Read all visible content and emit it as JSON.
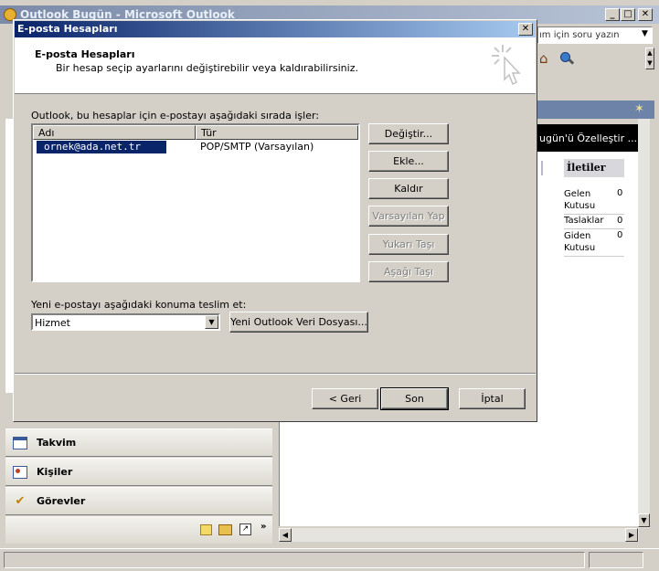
{
  "outlook": {
    "title": "Outlook Bugün - Microsoft Outlook",
    "help_search": "ım için soru yazın",
    "customize_label": "ugün'ü Özelleştir ...",
    "messages_panel": {
      "heading": "İletiler",
      "rows": [
        {
          "label": "Gelen Kutusu",
          "count": "0"
        },
        {
          "label": "Taslaklar",
          "count": "0"
        },
        {
          "label": "Giden Kutusu",
          "count": "0"
        }
      ]
    },
    "nav": {
      "calendar": "Takvim",
      "contacts": "Kişiler",
      "tasks": "Görevler"
    }
  },
  "dialog": {
    "title": "E-posta Hesapları",
    "header_title": "E-posta Hesapları",
    "header_subtitle": "Bir hesap seçip ayarlarını değiştirebilir veya kaldırabilirsiniz.",
    "order_text": "Outlook, bu hesaplar için e-postayı aşağıdaki sırada işler:",
    "columns": {
      "name": "Adı",
      "type": "Tür"
    },
    "accounts": [
      {
        "name": "ornek@ada.net.tr",
        "type": "POP/SMTP (Varsayılan)"
      }
    ],
    "side_buttons": {
      "change": "Değiştir...",
      "add": "Ekle...",
      "remove": "Kaldır",
      "set_default": "Varsayılan Yap",
      "move_up": "Yukarı Taşı",
      "move_down": "Aşağı Taşı"
    },
    "deliver_label": "Yeni e-postayı aşağıdaki konuma teslim et:",
    "deliver_value": "Hizmet",
    "new_data_file": "Yeni Outlook Veri Dosyası...",
    "footer": {
      "back": "< Geri",
      "finish": "Son",
      "cancel": "İptal"
    }
  }
}
